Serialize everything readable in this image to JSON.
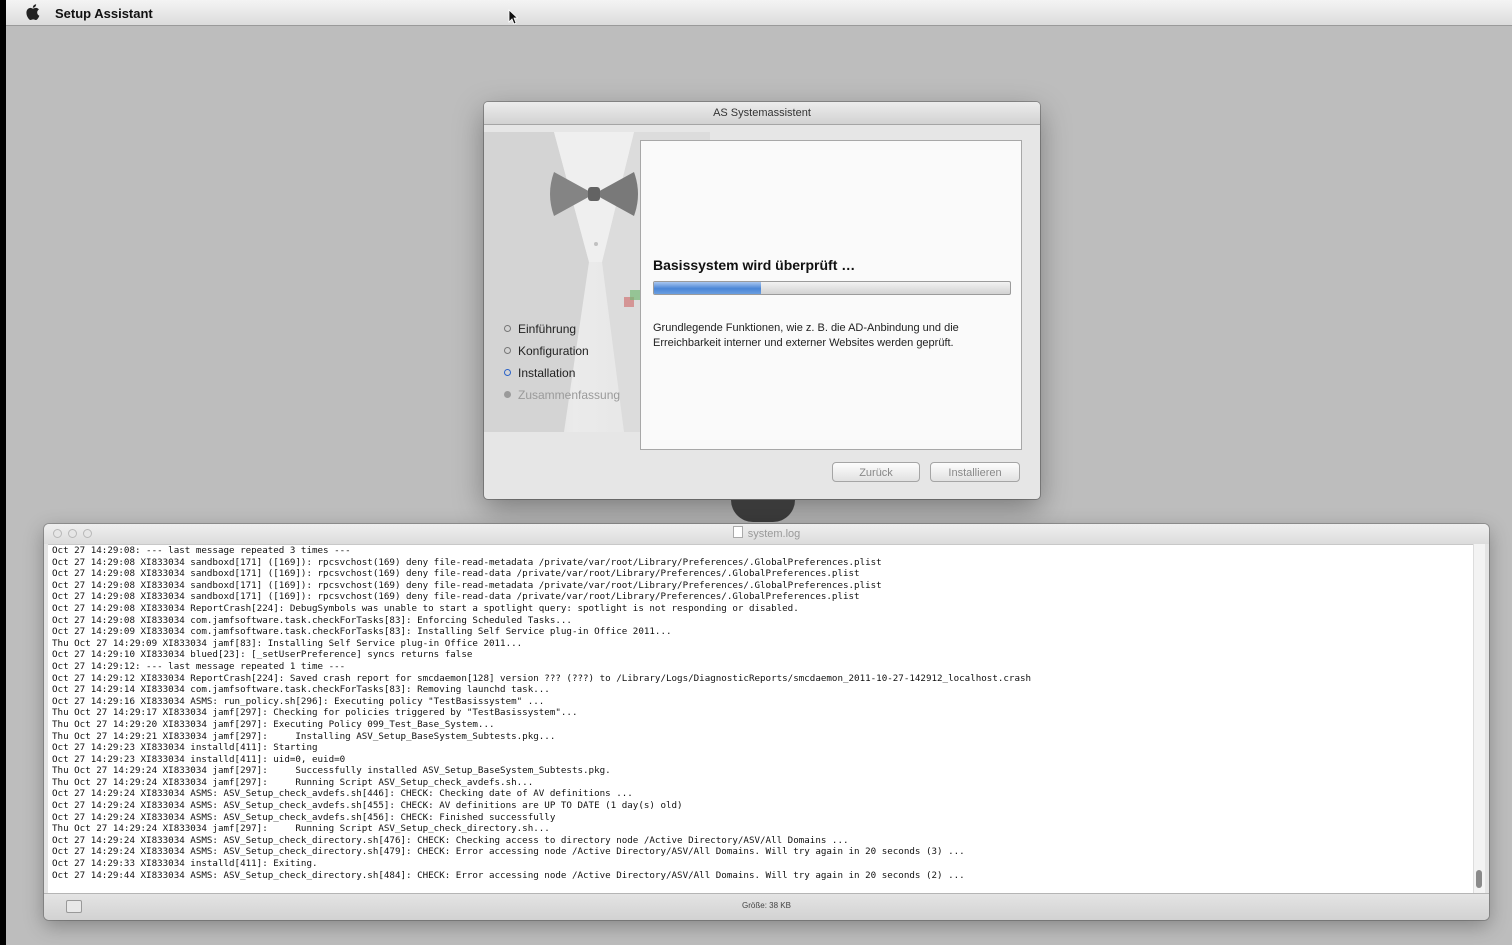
{
  "menubar": {
    "app_name": "Setup Assistant"
  },
  "setup_window": {
    "title": "AS Systemassistent",
    "steps": [
      {
        "label": "Einführung",
        "state": "done"
      },
      {
        "label": "Konfiguration",
        "state": "done"
      },
      {
        "label": "Installation",
        "state": "active"
      },
      {
        "label": "Zusammenfassung",
        "state": "pending"
      }
    ],
    "status_title": "Basissystem wird überprüft …",
    "progress_fraction": 0.3,
    "description": "Grundlegende Funktionen, wie z. B. die AD-Anbindung und die Erreichbarkeit interner und externer Websites werden geprüft.",
    "back_label": "Zurück",
    "install_label": "Installieren"
  },
  "log_window": {
    "title": "system.log",
    "size_label": "Größe: 38 KB",
    "lines": [
      "Oct 27 14:29:08: --- last message repeated 3 times ---",
      "Oct 27 14:29:08 XI833034 sandboxd[171] ([169]): rpcsvchost(169) deny file-read-metadata /private/var/root/Library/Preferences/.GlobalPreferences.plist",
      "Oct 27 14:29:08 XI833034 sandboxd[171] ([169]): rpcsvchost(169) deny file-read-data /private/var/root/Library/Preferences/.GlobalPreferences.plist",
      "Oct 27 14:29:08 XI833034 sandboxd[171] ([169]): rpcsvchost(169) deny file-read-metadata /private/var/root/Library/Preferences/.GlobalPreferences.plist",
      "Oct 27 14:29:08 XI833034 sandboxd[171] ([169]): rpcsvchost(169) deny file-read-data /private/var/root/Library/Preferences/.GlobalPreferences.plist",
      "Oct 27 14:29:08 XI833034 ReportCrash[224]: DebugSymbols was unable to start a spotlight query: spotlight is not responding or disabled.",
      "Oct 27 14:29:08 XI833034 com.jamfsoftware.task.checkForTasks[83]: Enforcing Scheduled Tasks...",
      "Oct 27 14:29:09 XI833034 com.jamfsoftware.task.checkForTasks[83]: Installing Self Service plug-in Office 2011...",
      "Thu Oct 27 14:29:09 XI833034 jamf[83]: Installing Self Service plug-in Office 2011...",
      "Oct 27 14:29:10 XI833034 blued[23]: [_setUserPreference] syncs returns false",
      "Oct 27 14:29:12: --- last message repeated 1 time ---",
      "Oct 27 14:29:12 XI833034 ReportCrash[224]: Saved crash report for smcdaemon[128] version ??? (???) to /Library/Logs/DiagnosticReports/smcdaemon_2011-10-27-142912_localhost.crash",
      "Oct 27 14:29:14 XI833034 com.jamfsoftware.task.checkForTasks[83]: Removing launchd task...",
      "Oct 27 14:29:16 XI833034 ASMS: run_policy.sh[296]: Executing policy \"TestBasissystem\" ...",
      "Thu Oct 27 14:29:17 XI833034 jamf[297]: Checking for policies triggered by \"TestBasissystem\"...",
      "Thu Oct 27 14:29:20 XI833034 jamf[297]: Executing Policy 099_Test_Base_System...",
      "Thu Oct 27 14:29:21 XI833034 jamf[297]:     Installing ASV_Setup_BaseSystem_Subtests.pkg...",
      "Oct 27 14:29:23 XI833034 installd[411]: Starting",
      "Oct 27 14:29:23 XI833034 installd[411]: uid=0, euid=0",
      "Thu Oct 27 14:29:24 XI833034 jamf[297]:     Successfully installed ASV_Setup_BaseSystem_Subtests.pkg.",
      "Thu Oct 27 14:29:24 XI833034 jamf[297]:     Running Script ASV_Setup_check_avdefs.sh...",
      "Oct 27 14:29:24 XI833034 ASMS: ASV_Setup_check_avdefs.sh[446]: CHECK: Checking date of AV definitions ...",
      "Oct 27 14:29:24 XI833034 ASMS: ASV_Setup_check_avdefs.sh[455]: CHECK: AV definitions are UP TO DATE (1 day(s) old)",
      "Oct 27 14:29:24 XI833034 ASMS: ASV_Setup_check_avdefs.sh[456]: CHECK: Finished successfully",
      "Thu Oct 27 14:29:24 XI833034 jamf[297]:     Running Script ASV_Setup_check_directory.sh...",
      "Oct 27 14:29:24 XI833034 ASMS: ASV_Setup_check_directory.sh[476]: CHECK: Checking access to directory node /Active Directory/ASV/All Domains ...",
      "Oct 27 14:29:24 XI833034 ASMS: ASV_Setup_check_directory.sh[479]: CHECK: Error accessing node /Active Directory/ASV/All Domains. Will try again in 20 seconds (3) ...",
      "Oct 27 14:29:33 XI833034 installd[411]: Exiting.",
      "Oct 27 14:29:44 XI833034 ASMS: ASV_Setup_check_directory.sh[484]: CHECK: Error accessing node /Active Directory/ASV/All Domains. Will try again in 20 seconds (2) ..."
    ]
  }
}
